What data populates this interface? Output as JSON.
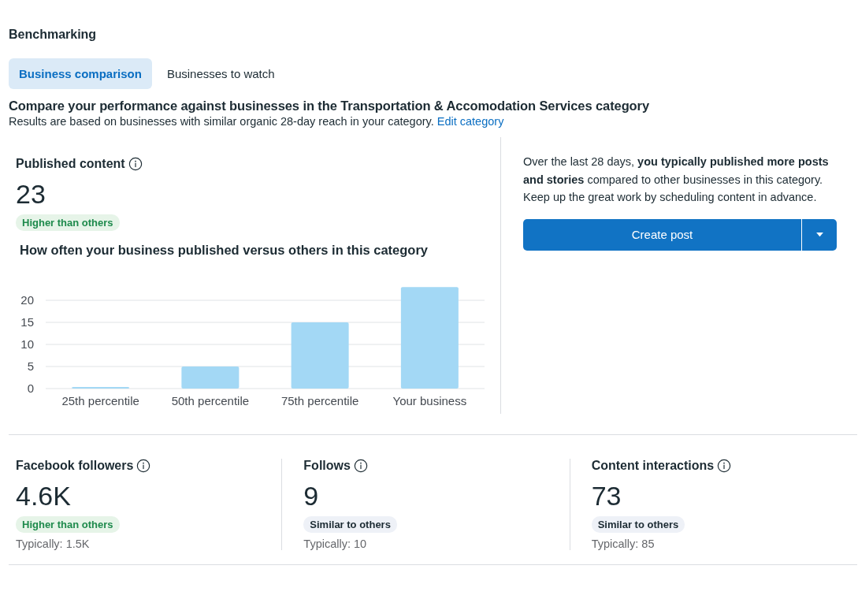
{
  "section_title": "Benchmarking",
  "tabs": [
    {
      "label": "Business comparison",
      "selected": true
    },
    {
      "label": "Businesses to watch",
      "selected": false
    }
  ],
  "heading": "Compare your performance against businesses in the Transportation & Accomodation Services category",
  "subtitle": "Results are based on businesses with similar organic 28-day reach in your category.",
  "subtitle_link": "Edit category",
  "published": {
    "label": "Published content",
    "value": "23",
    "badge": {
      "kind": "higher",
      "text": "Higher than others"
    },
    "chart_data": {
      "type": "bar",
      "title": "How often your business published versus others in this category",
      "categories": [
        "25th percentile",
        "50th percentile",
        "75th percentile",
        "Your business"
      ],
      "series": [
        {
          "color": "#a3d8f5",
          "values": [
            0,
            5,
            15,
            23
          ]
        }
      ],
      "yticks": [
        0,
        5,
        10,
        15,
        20
      ],
      "ylim": [
        0,
        23
      ],
      "grid": true
    }
  },
  "summary": "Over the last 28 days, **you typically published more posts and stories** compared to other businesses in this category. Keep up the great work by scheduling content in advance.",
  "create_button": "Create post",
  "metrics": [
    {
      "label": "Facebook followers",
      "value": "4.6K",
      "badge": {
        "kind": "higher",
        "text": "Higher than others"
      },
      "typical": "Typically: 1.5K"
    },
    {
      "label": "Follows",
      "value": "9",
      "badge": {
        "kind": "similar",
        "text": "Similar to others"
      },
      "typical": "Typically: 10"
    },
    {
      "label": "Content interactions",
      "value": "73",
      "badge": {
        "kind": "similar",
        "text": "Similar to others"
      },
      "typical": "Typically: 85"
    }
  ]
}
